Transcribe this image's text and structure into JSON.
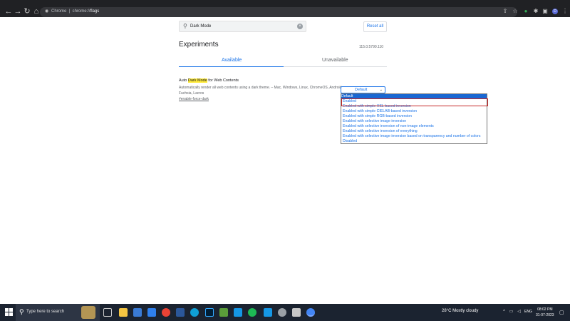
{
  "browser": {
    "site_label": "Chrome",
    "url_prefix": "chrome://",
    "url_path": "flags"
  },
  "page": {
    "search_value": "Dark Mode",
    "reset_label": "Reset all",
    "heading": "Experiments",
    "version": "115.0.5790.110",
    "tabs": [
      {
        "label": "Available"
      },
      {
        "label": "Unavailable"
      }
    ],
    "flag": {
      "title_prefix": "Auto ",
      "title_highlight": "Dark Mode",
      "title_suffix": " for Web Contents",
      "description": "Automatically render all web contents using a dark theme. – Mac, Windows, Linux, ChromeOS, Android, Fuchsia, Lacros",
      "link": "#enable-force-dark",
      "select_value": "Default",
      "options": [
        {
          "label": "Default"
        },
        {
          "label": "Enabled"
        },
        {
          "label": "Enabled with simple HSL-based inversion"
        },
        {
          "label": "Enabled with simple CIELAB-based inversion"
        },
        {
          "label": "Enabled with simple RGB-based inversion"
        },
        {
          "label": "Enabled with selective image inversion"
        },
        {
          "label": "Enabled with selective inversion of non-image elements"
        },
        {
          "label": "Enabled with selective inversion of everything"
        },
        {
          "label": "Enabled with selective image inversion based on transparency and number of colors"
        },
        {
          "label": "Disabled"
        }
      ]
    }
  },
  "taskbar": {
    "search_placeholder": "Type here to search",
    "weather": "28°C  Mostly cloudy",
    "lang": "ENG",
    "time": "08:02 PM",
    "date": "31-07-2023"
  },
  "colors": {
    "accent": "#1a73e8",
    "highlight": "#ffeb3b",
    "selection_box": "#c62828"
  }
}
